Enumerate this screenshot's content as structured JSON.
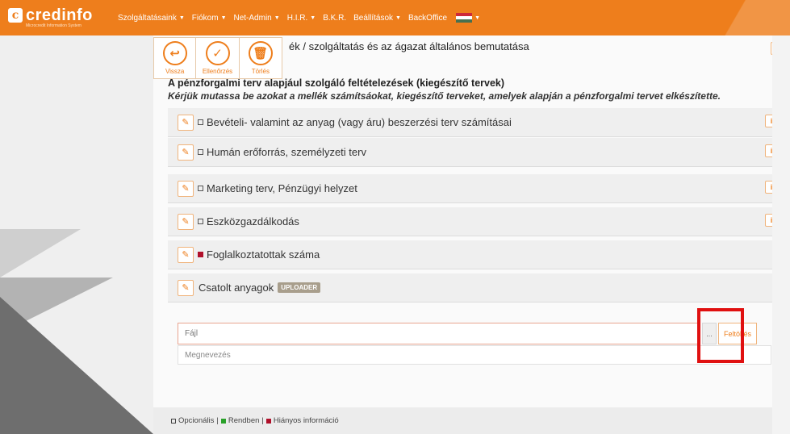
{
  "brand": {
    "name": "credinfo",
    "tagline": "Microcredit Information System"
  },
  "nav": [
    {
      "label": "Szolgáltatásaink"
    },
    {
      "label": "Fiókom"
    },
    {
      "label": "Net-Admin"
    },
    {
      "label": "H.I.R."
    },
    {
      "label": "B.K.R."
    },
    {
      "label": "Beállítások"
    },
    {
      "label": "BackOffice"
    }
  ],
  "toolbar": {
    "back_label": "Vissza",
    "check_label": "Ellenőrzés",
    "delete_label": "Törlés"
  },
  "headings": {
    "top_section": "ék / szolgáltatás és az ágazat általános bemutatása",
    "section_title": "A pénzforgalmi terv alapjául szolgáló feltételezések (kiegészítő tervek)",
    "section_desc": "Kérjük mutassa be azokat a mellék számítsáokat, kiegészítő terveket, amelyek alapján a pénzforgalmi tervet elkészítette."
  },
  "sections": [
    {
      "label": "Bevételi- valamint az anyag (vagy áru) beszerzési terv számításai",
      "status": "optional"
    },
    {
      "label": "Humán erőforrás, személyzeti terv",
      "status": "optional"
    },
    {
      "label": "Marketing terv, Pénzügyi helyzet",
      "status": "optional"
    },
    {
      "label": "Eszközgazdálkodás",
      "status": "optional"
    },
    {
      "label": "Foglalkoztatottak száma",
      "status": "missing"
    }
  ],
  "attachments": {
    "label": "Csatolt anyagok",
    "badge": "UPLOADER",
    "file_placeholder": "Fájl",
    "browse_label": "...",
    "upload_label": "Feltöltés",
    "name_placeholder": "Megnevezés"
  },
  "legend": {
    "optional": "Opcionális",
    "ok": "Rendben",
    "missing": "Hiányos információ"
  },
  "colors": {
    "accent": "#ee7e1c",
    "missing": "#b0102a",
    "ok": "#2aa12a",
    "highlight": "#e01010"
  }
}
